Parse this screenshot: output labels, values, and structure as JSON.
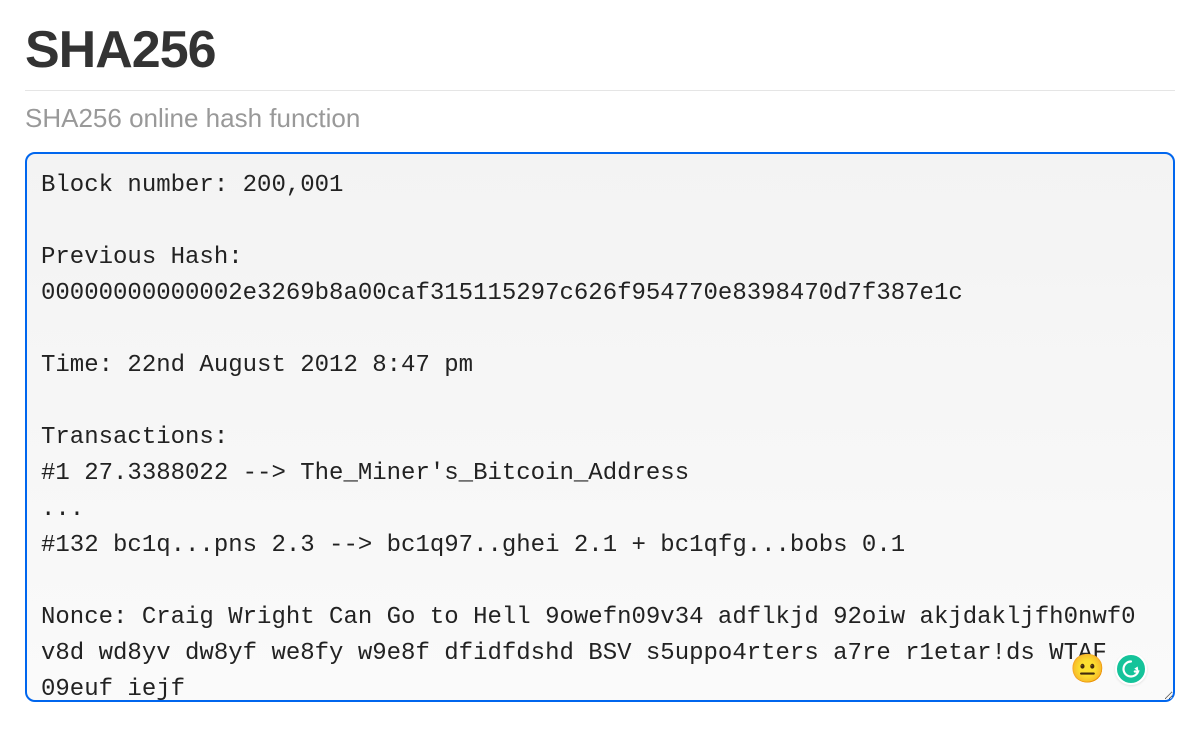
{
  "header": {
    "title": "SHA256",
    "subtitle": "SHA256 online hash function"
  },
  "input": {
    "value": "Block number: 200,001\n\nPrevious Hash: 00000000000002e3269b8a00caf315115297c626f954770e8398470d7f387e1c\n\nTime: 22nd August 2012 8:47 pm\n\nTransactions:\n#1 27.3388022 --> The_Miner's_Bitcoin_Address\n...\n#132 bc1q...pns 2.3 --> bc1q97..ghei 2.1 + bc1qfg...bobs 0.1\n\nNonce: Craig Wright Can Go to Hell 9owefn09v34 adflkjd 92oiw akjdakljfh0nwf0 v8d wd8yv dw8yf we8fy w9e8f dfidfdshd BSV s5uppo4rters a7re r1etar!ds WTAF 09euf iejf"
  },
  "overlay": {
    "emoji": "😐",
    "grammarly_label": "G"
  }
}
